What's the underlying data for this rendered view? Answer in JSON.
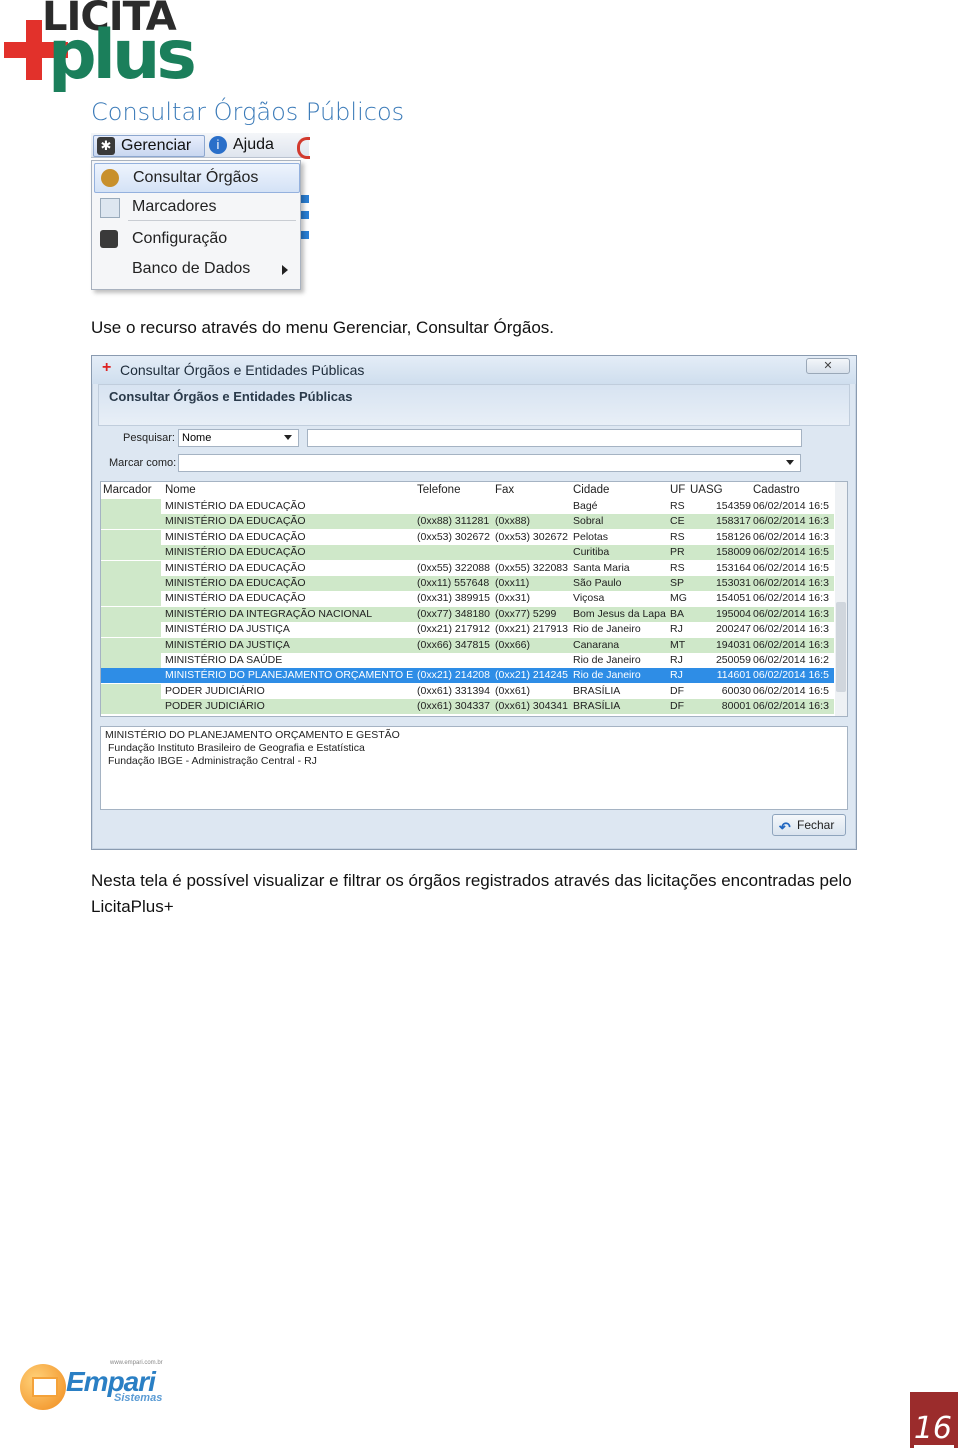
{
  "logo": {
    "top_text": "LICITA",
    "bottom_text": "plus"
  },
  "page_title": "Consultar Órgãos Públicos",
  "menu_screenshot": {
    "menubar": [
      "Gerenciar",
      "Ajuda"
    ],
    "items": [
      "Consultar Órgãos",
      "Marcadores",
      "Configuração",
      "Banco de Dados"
    ]
  },
  "paragraph1": "Use o recurso através do menu Gerenciar, Consultar Órgãos.",
  "dialog": {
    "window_title": "Consultar Órgãos e Entidades Públicas",
    "header": "Consultar Órgãos e Entidades Públicas",
    "search_label": "Pesquisar:",
    "search_field": "Nome",
    "mark_label": "Marcar como:",
    "columns": [
      "Marcador",
      "Nome",
      "Telefone",
      "Fax",
      "Cidade",
      "UF",
      "UASG",
      "Cadastro"
    ],
    "rows": [
      {
        "nome": "MINISTÉRIO DA EDUCAÇÃO",
        "tel": "",
        "fax": "",
        "cidade": "Bagé",
        "uf": "RS",
        "uasg": "154359",
        "cad": "06/02/2014 16:5",
        "style": "white"
      },
      {
        "nome": "MINISTÉRIO DA EDUCAÇÃO",
        "tel": "(0xx88) 311281",
        "fax": "(0xx88)",
        "cidade": "Sobral",
        "uf": "CE",
        "uasg": "158317",
        "cad": "06/02/2014 16:3",
        "style": "green"
      },
      {
        "nome": "MINISTÉRIO DA EDUCAÇÃO",
        "tel": "(0xx53) 302672",
        "fax": "(0xx53) 302672",
        "cidade": "Pelotas",
        "uf": "RS",
        "uasg": "158126",
        "cad": "06/02/2014 16:3",
        "style": "white"
      },
      {
        "nome": "MINISTÉRIO DA EDUCAÇÃO",
        "tel": "",
        "fax": "",
        "cidade": "Curitiba",
        "uf": "PR",
        "uasg": "158009",
        "cad": "06/02/2014 16:5",
        "style": "green"
      },
      {
        "nome": "MINISTÉRIO DA EDUCAÇÃO",
        "tel": "(0xx55) 322088",
        "fax": "(0xx55) 322083",
        "cidade": "Santa Maria",
        "uf": "RS",
        "uasg": "153164",
        "cad": "06/02/2014 16:5",
        "style": "white"
      },
      {
        "nome": "MINISTÉRIO DA EDUCAÇÃO",
        "tel": "(0xx11) 557648",
        "fax": "(0xx11)",
        "cidade": "São Paulo",
        "uf": "SP",
        "uasg": "153031",
        "cad": "06/02/2014 16:3",
        "style": "green"
      },
      {
        "nome": "MINISTÉRIO DA EDUCAÇÃO",
        "tel": "(0xx31) 389915",
        "fax": "(0xx31)",
        "cidade": "Viçosa",
        "uf": "MG",
        "uasg": "154051",
        "cad": "06/02/2014 16:3",
        "style": "white"
      },
      {
        "nome": "MINISTÉRIO DA INTEGRAÇÃO NACIONAL",
        "tel": "(0xx77) 348180",
        "fax": "(0xx77) 5299",
        "cidade": "Bom Jesus da Lapa",
        "uf": "BA",
        "uasg": "195004",
        "cad": "06/02/2014 16:3",
        "style": "green"
      },
      {
        "nome": "MINISTÉRIO DA JUSTIÇA",
        "tel": "(0xx21) 217912",
        "fax": "(0xx21) 217913",
        "cidade": "Rio de Janeiro",
        "uf": "RJ",
        "uasg": "200247",
        "cad": "06/02/2014 16:3",
        "style": "white"
      },
      {
        "nome": "MINISTÉRIO DA JUSTIÇA",
        "tel": "(0xx66) 347815",
        "fax": "(0xx66)",
        "cidade": "Canarana",
        "uf": "MT",
        "uasg": "194031",
        "cad": "06/02/2014 16:3",
        "style": "green"
      },
      {
        "nome": "MINISTÉRIO DA SAÚDE",
        "tel": "",
        "fax": "",
        "cidade": "Rio de Janeiro",
        "uf": "RJ",
        "uasg": "250059",
        "cad": "06/02/2014 16:2",
        "style": "white"
      },
      {
        "nome": "MINISTÉRIO DO PLANEJAMENTO ORÇAMENTO E GES",
        "tel": "(0xx21) 214208",
        "fax": "(0xx21) 214245",
        "cidade": "Rio de Janeiro",
        "uf": "RJ",
        "uasg": "114601",
        "cad": "06/02/2014 16:5",
        "style": "sel-row"
      },
      {
        "nome": "PODER JUDICIÁRIO",
        "tel": "(0xx61) 331394",
        "fax": "(0xx61)",
        "cidade": "BRASÍLIA",
        "uf": "DF",
        "uasg": "60030",
        "cad": "06/02/2014 16:5",
        "style": "white"
      },
      {
        "nome": "PODER JUDICIÁRIO",
        "tel": "(0xx61) 304337",
        "fax": "(0xx61) 304341",
        "cidade": "BRASÍLIA",
        "uf": "DF",
        "uasg": "80001",
        "cad": "06/02/2014 16:3",
        "style": "green"
      }
    ],
    "details": [
      "MINISTÉRIO DO PLANEJAMENTO ORÇAMENTO E GESTÃO",
      "Fundação Instituto Brasileiro de Geografia e Estatística",
      "Fundação IBGE - Administração Central - RJ"
    ],
    "close_button": "Fechar"
  },
  "paragraph2": "Nesta tela é possível visualizar e filtrar os órgãos registrados através das licitações encontradas pelo LicitaPlus+",
  "footer": {
    "brand": "Empari",
    "sub": "Sistemas",
    "url": "www.empari.com.br"
  },
  "page_number": "16"
}
